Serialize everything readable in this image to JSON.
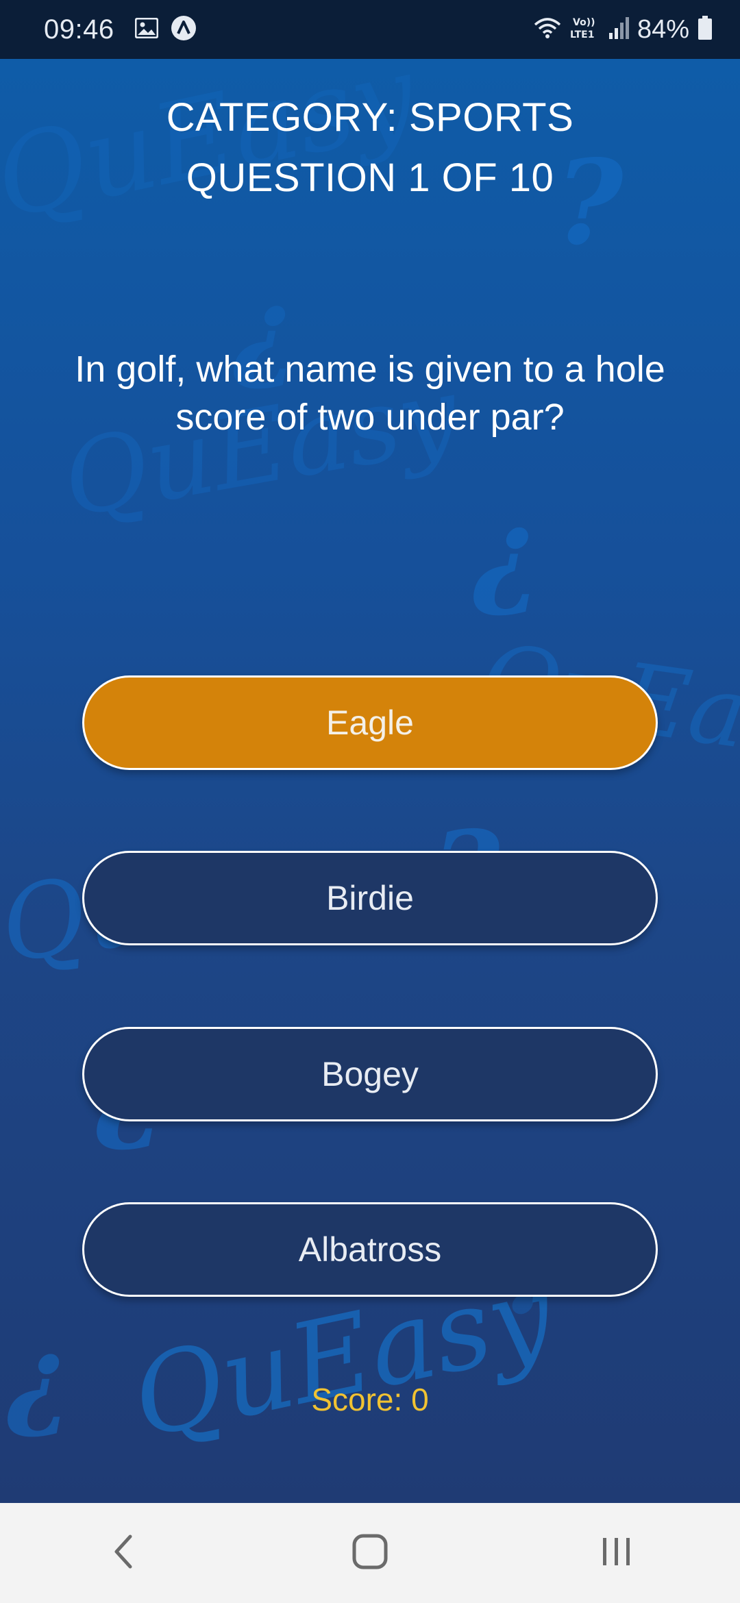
{
  "status_bar": {
    "time": "09:46",
    "left_icons": [
      "image-icon",
      "app-a-icon"
    ],
    "right_icons": [
      "wifi-icon",
      "volte-lte1-icon",
      "signal-icon",
      "battery-icon"
    ],
    "network_label": "Vo)) LTE1",
    "battery": "84%"
  },
  "app": {
    "watermark": "QuEasy",
    "category_line": "CATEGORY: SPORTS",
    "progress_line": "QUESTION 1 OF 10",
    "question": "In golf, what name is given to a hole score of two under par?",
    "answers": [
      {
        "label": "Eagle",
        "selected": true
      },
      {
        "label": "Birdie",
        "selected": false
      },
      {
        "label": "Bogey",
        "selected": false
      },
      {
        "label": "Albatross",
        "selected": false
      }
    ],
    "score": "Score: 0",
    "colors": {
      "selected_answer": "#d4830a",
      "answer_bg": "#1e3766",
      "score_text": "#f1c232",
      "background_top": "#0f5ca8",
      "background_bottom": "#1f3b74"
    }
  },
  "nav_bar": {
    "buttons": [
      "back-icon",
      "home-icon",
      "recents-icon"
    ]
  }
}
